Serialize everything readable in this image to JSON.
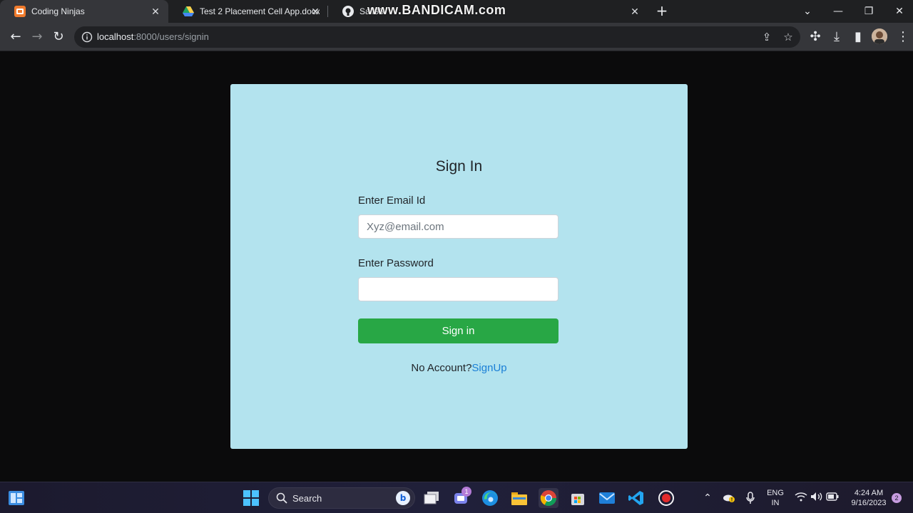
{
  "browser": {
    "tabs": [
      {
        "title": "Coding Ninjas",
        "favicon": "coding-ninjas-icon"
      },
      {
        "title": "Test 2 Placement Cell App.docx -",
        "favicon": "google-drive-icon"
      },
      {
        "title": "Saif95",
        "favicon": "github-icon"
      }
    ],
    "recording_watermark": "www.BANDICAM.com",
    "url_host": "localhost",
    "url_rest": ":8000/users/signin"
  },
  "page": {
    "title": "Sign In",
    "email_label": "Enter Email Id",
    "email_placeholder": "Xyz@email.com",
    "password_label": "Enter Password",
    "signin_button": "Sign in",
    "no_account_text": "No Account?",
    "signup_link": "SignUp",
    "colors": {
      "card_bg": "#b3e3ee",
      "button_bg": "#28a745",
      "link": "#1a7fd6"
    }
  },
  "taskbar": {
    "search_label": "Search",
    "teams_badge": "1",
    "language_line1": "ENG",
    "language_line2": "IN",
    "time": "4:24 AM",
    "date": "9/16/2023",
    "notification_count": "2"
  }
}
